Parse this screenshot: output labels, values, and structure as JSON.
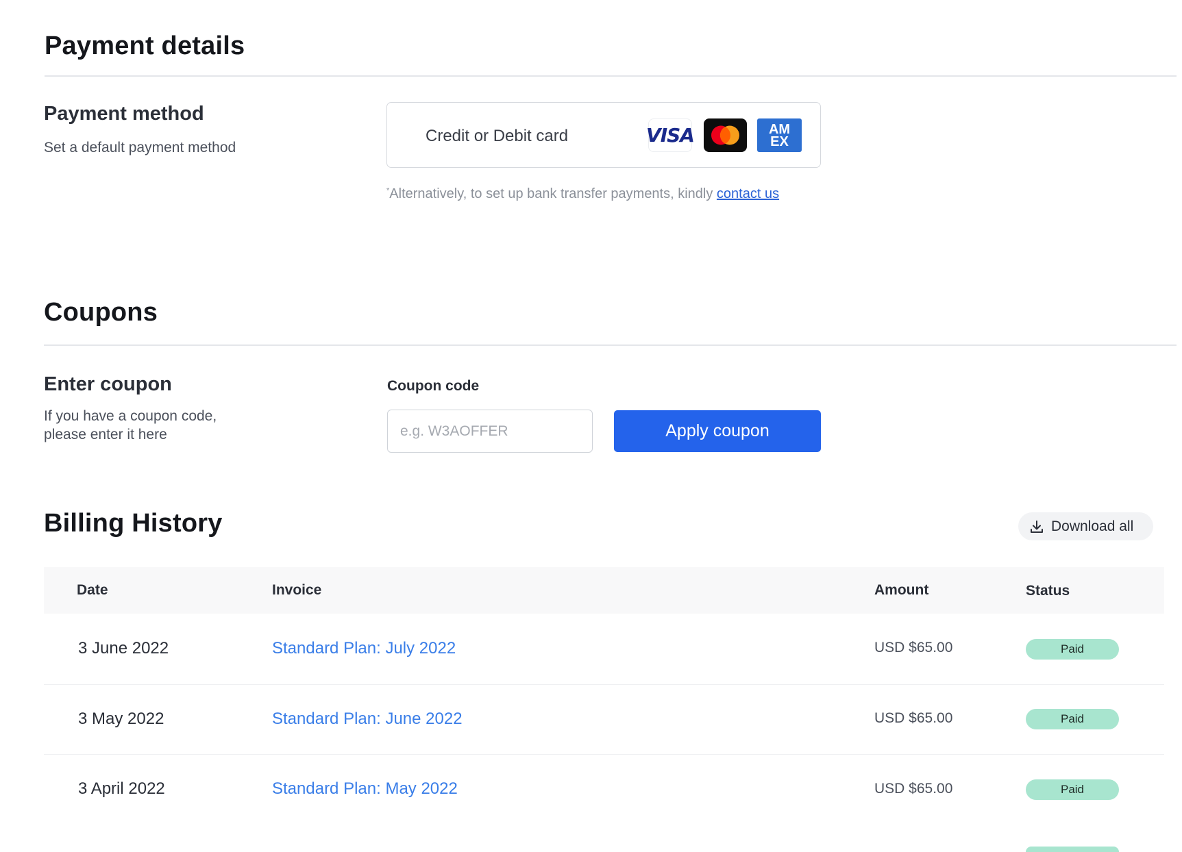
{
  "payment": {
    "title": "Payment details",
    "method_heading": "Payment method",
    "method_sub": "Set a default payment method",
    "card_label": "Credit or Debit card",
    "brands": {
      "visa": "VISA",
      "amex_top": "AM",
      "amex_bottom": "EX"
    },
    "note_mark": "*",
    "note_text": "Alternatively, to set up bank transfer payments, kindly ",
    "note_link": "contact us"
  },
  "coupons": {
    "title": "Coupons",
    "heading": "Enter coupon",
    "sub_line1": "If you have a coupon code,",
    "sub_line2": "please enter it here",
    "field_label": "Coupon code",
    "placeholder": "e.g. W3AOFFER",
    "value": "",
    "apply_label": "Apply coupon"
  },
  "billing": {
    "title": "Billing History",
    "download_label": "Download all",
    "columns": {
      "date": "Date",
      "invoice": "Invoice",
      "amount": "Amount",
      "status": "Status"
    },
    "rows": [
      {
        "date": "3 June 2022",
        "invoice": "Standard Plan: July 2022",
        "amount": "USD $65.00",
        "status": "Paid"
      },
      {
        "date": "3 May 2022",
        "invoice": "Standard Plan: June 2022",
        "amount": "USD $65.00",
        "status": "Paid"
      },
      {
        "date": "3 April 2022",
        "invoice": "Standard Plan: May 2022",
        "amount": "USD $65.00",
        "status": "Paid"
      }
    ]
  },
  "colors": {
    "primary": "#2463eb",
    "link": "#3a7ee8",
    "paid_badge": "#a8e5cf",
    "divider": "#e4e6ea"
  },
  "icons": [
    "visa-logo",
    "mastercard-logo",
    "amex-logo",
    "download-icon"
  ]
}
